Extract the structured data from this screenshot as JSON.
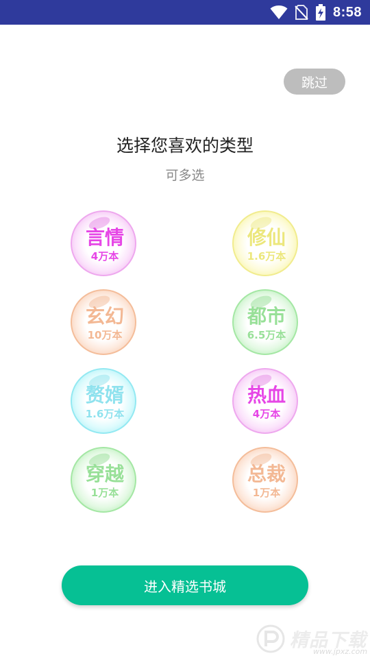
{
  "status_bar": {
    "time": "8:58",
    "icons": [
      "wifi-icon",
      "no-sim-icon",
      "battery-charging-icon"
    ]
  },
  "skip_label": "跳过",
  "title": "选择您喜欢的类型",
  "subtitle": "可多选",
  "genres": [
    {
      "name": "言情",
      "count": "4万本",
      "color": "#e646e6"
    },
    {
      "name": "修仙",
      "count": "1.6万本",
      "color": "#ece77c"
    },
    {
      "name": "玄幻",
      "count": "10万本",
      "color": "#f3b894"
    },
    {
      "name": "都市",
      "count": "6.5万本",
      "color": "#98e098"
    },
    {
      "name": "赘婿",
      "count": "1.6万本",
      "color": "#8fe2ee"
    },
    {
      "name": "热血",
      "count": "4万本",
      "color": "#e646e6"
    },
    {
      "name": "穿越",
      "count": "1万本",
      "color": "#98e098"
    },
    {
      "name": "总裁",
      "count": "1万本",
      "color": "#f3b894"
    }
  ],
  "enter_button_label": "进入精选书城",
  "watermark": {
    "text": "精品下载",
    "url": "www.jpxz.com"
  },
  "colors": {
    "status_bar": "#2f3a9c",
    "accent": "#06c094",
    "skip_button": "#bdbdbd"
  }
}
